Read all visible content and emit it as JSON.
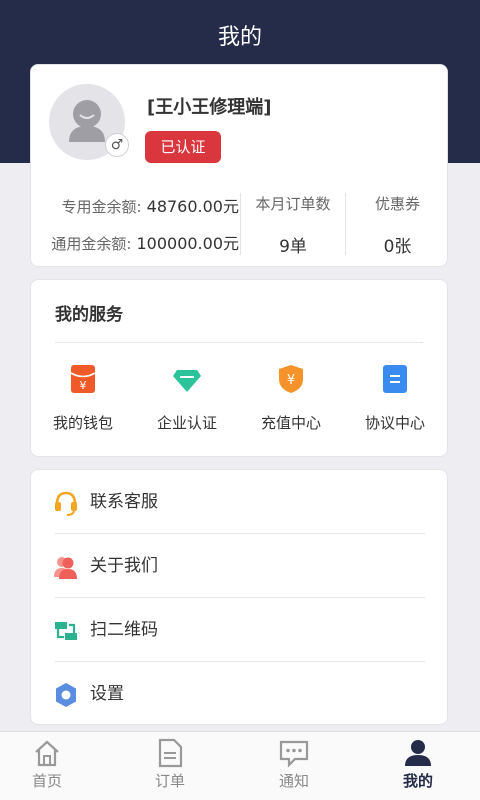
{
  "header": {
    "title": "我的"
  },
  "profile": {
    "username": "[王小王修理端]",
    "certification": "已认证",
    "gender_symbol": "♂",
    "balances": [
      {
        "label": "专用金余额:",
        "value": "48760.00元"
      },
      {
        "label": "通用金余额:",
        "value": "100000.00元"
      }
    ],
    "stats": [
      {
        "label": "本月订单数",
        "value": "9单"
      },
      {
        "label": "优惠券",
        "value": "0张"
      }
    ]
  },
  "services": {
    "title": "我的服务",
    "items": [
      {
        "label": "我的钱包",
        "icon": "red-envelope-icon",
        "color": "#f05a28"
      },
      {
        "label": "企业认证",
        "icon": "diamond-icon",
        "color": "#2cc39a"
      },
      {
        "label": "充值中心",
        "icon": "yuan-shield-icon",
        "color": "#f5922a"
      },
      {
        "label": "协议中心",
        "icon": "document-icon",
        "color": "#3a8bef"
      }
    ]
  },
  "menu": {
    "items": [
      {
        "label": "联系客服",
        "icon": "headset-icon",
        "color": "#f5a623"
      },
      {
        "label": "关于我们",
        "icon": "users-icon",
        "color": "#f0605a"
      },
      {
        "label": "扫二维码",
        "icon": "scan-icon",
        "color": "#2ab38e"
      },
      {
        "label": "设置",
        "icon": "gear-icon",
        "color": "#5a8de0"
      }
    ]
  },
  "tabbar": {
    "items": [
      {
        "label": "首页",
        "icon": "home-icon",
        "active": false
      },
      {
        "label": "订单",
        "icon": "order-icon",
        "active": false
      },
      {
        "label": "通知",
        "icon": "message-icon",
        "active": false
      },
      {
        "label": "我的",
        "icon": "user-icon",
        "active": true
      }
    ]
  },
  "colors": {
    "header": "#252c4a",
    "accent_red": "#d9363e"
  }
}
